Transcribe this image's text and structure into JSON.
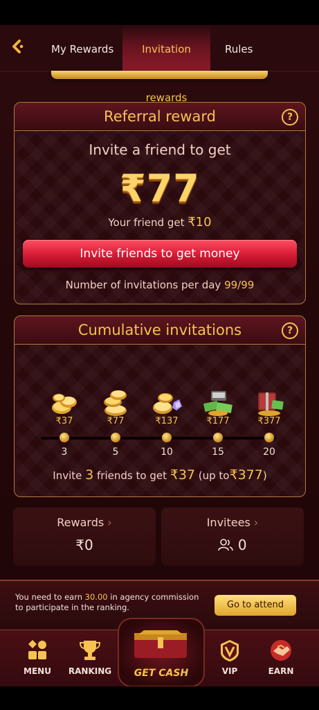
{
  "header": {
    "tabs": [
      {
        "label": "My Rewards"
      },
      {
        "label": "Invitation rewards",
        "active": true
      },
      {
        "label": "Rules"
      }
    ]
  },
  "referral": {
    "title": "Referral reward",
    "invite_text": "Invite a friend to get",
    "amount": "₹77",
    "friend_text": "Your friend get",
    "friend_amount": "₹10",
    "button_label": "Invite friends to get money",
    "limit_text": "Number of invitations per day",
    "limit_value": "99/99"
  },
  "cumulative": {
    "title": "Cumulative invitations",
    "milestones": [
      {
        "reward": "₹37",
        "count": "3"
      },
      {
        "reward": "₹77",
        "count": "5"
      },
      {
        "reward": "₹137",
        "count": "10"
      },
      {
        "reward": "₹177",
        "count": "15"
      },
      {
        "reward": "₹377",
        "count": "20"
      }
    ],
    "text_prefix": "Invite",
    "text_count": "3",
    "text_mid": "friends to get",
    "text_amount": "₹37",
    "text_upto_prefix": "(up to",
    "text_upto": "₹377",
    "text_close": ")"
  },
  "stats": {
    "rewards_label": "Rewards",
    "rewards_value": "₹0",
    "invitees_label": "Invitees",
    "invitees_value": "0"
  },
  "ranking": {
    "text_before": "You need to earn",
    "amount": "30.00",
    "text_after": "in agency commission to participate in the ranking.",
    "button_label": "Go to attend"
  },
  "nav": {
    "menu": "MENU",
    "ranking": "RANKING",
    "get_cash": "GET CASH",
    "vip": "VIP",
    "earn": "EARN"
  },
  "colors": {
    "accent_gold": "#f6c351",
    "button_red": "#d51a33",
    "background": "#2d0b0e"
  }
}
